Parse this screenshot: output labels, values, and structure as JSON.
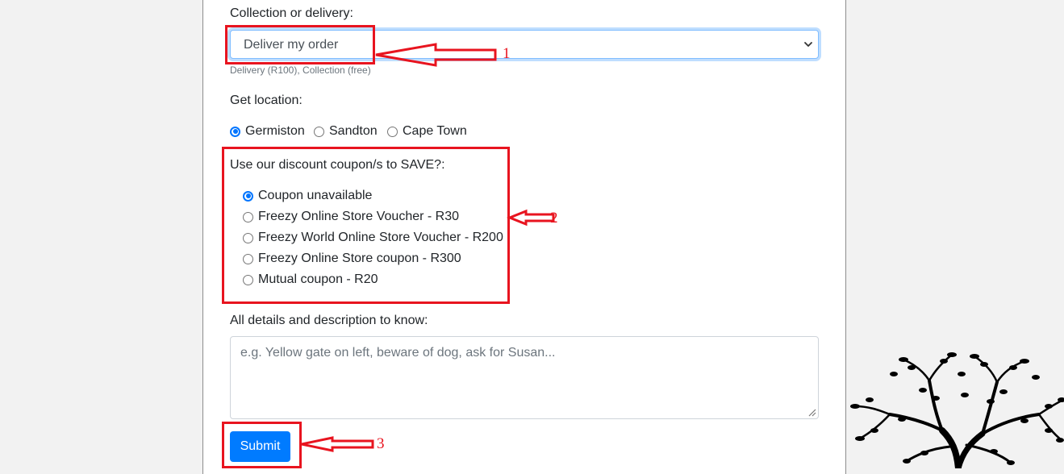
{
  "form": {
    "collection": {
      "label": "Collection or delivery:",
      "selected": "Deliver my order",
      "hint": "Delivery (R100), Collection (free)"
    },
    "location": {
      "label": "Get location:",
      "options": [
        {
          "label": "Germiston",
          "checked": true
        },
        {
          "label": "Sandton",
          "checked": false
        },
        {
          "label": "Cape Town",
          "checked": false
        }
      ]
    },
    "coupon": {
      "label": "Use our discount coupon/s to SAVE?:",
      "options": [
        {
          "label": "Coupon unavailable",
          "checked": true
        },
        {
          "label": "Freezy Online Store Voucher - R30",
          "checked": false
        },
        {
          "label": "Freezy World Online Store Voucher - R200",
          "checked": false
        },
        {
          "label": "Freezy Online Store coupon - R300",
          "checked": false
        },
        {
          "label": "Mutual coupon - R20",
          "checked": false
        }
      ]
    },
    "details": {
      "label": "All details and description to know:",
      "placeholder": "e.g. Yellow gate on left, beware of dog, ask for Susan..."
    },
    "submit_label": "Submit"
  },
  "annotations": {
    "one": "1",
    "two": "2",
    "three": "3",
    "color": "#e8141f"
  },
  "colors": {
    "primary": "#007bff",
    "radio_checked": "#0075ff",
    "background": "#f2f2f2"
  },
  "icons": [
    "chevron-down-icon",
    "resize-grip-icon",
    "red-arrow",
    "tree-illustration"
  ]
}
